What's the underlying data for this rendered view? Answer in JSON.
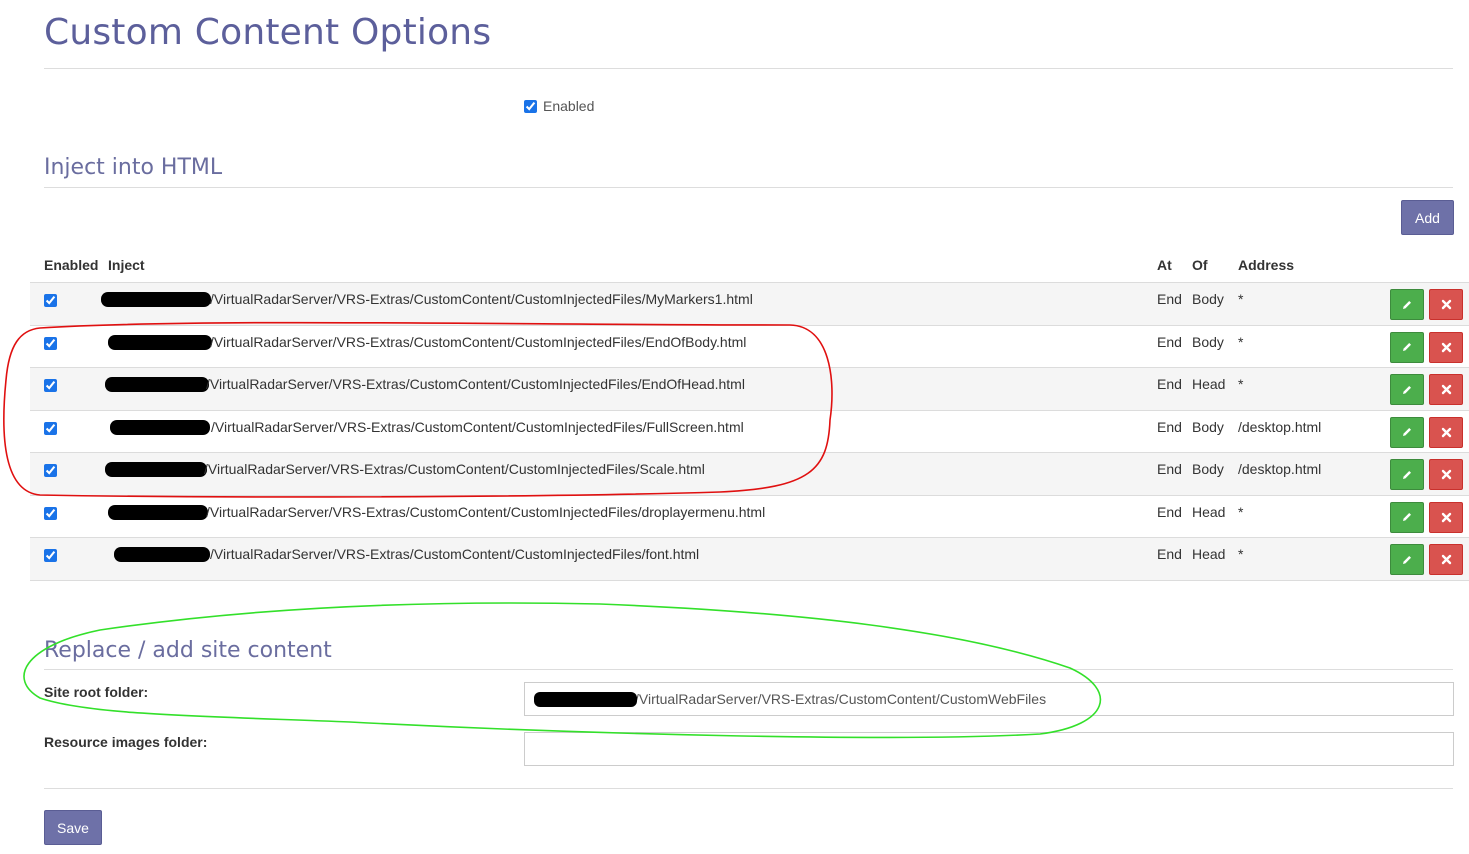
{
  "page": {
    "title": "Custom Content Options"
  },
  "enabled": {
    "label": "Enabled",
    "checked": true
  },
  "inject": {
    "section_title": "Inject into HTML",
    "add_label": "Add",
    "columns": {
      "enabled": "Enabled",
      "inject": "Inject",
      "at": "At",
      "of": "Of",
      "address": "Address"
    },
    "rows": [
      {
        "path": "/VirtualRadarServer/VRS-Extras/CustomContent/CustomInjectedFiles/MyMarkers1.html",
        "at": "End",
        "of": "Body",
        "address": "*",
        "enabled": true
      },
      {
        "path": "/VirtualRadarServer/VRS-Extras/CustomContent/CustomInjectedFiles/EndOfBody.html",
        "at": "End",
        "of": "Body",
        "address": "*",
        "enabled": true
      },
      {
        "path": "/VirtualRadarServer/VRS-Extras/CustomContent/CustomInjectedFiles/EndOfHead.html",
        "at": "End",
        "of": "Head",
        "address": "*",
        "enabled": true
      },
      {
        "path": "/VirtualRadarServer/VRS-Extras/CustomContent/CustomInjectedFiles/FullScreen.html",
        "at": "End",
        "of": "Body",
        "address": "/desktop.html",
        "enabled": true
      },
      {
        "path": "/VirtualRadarServer/VRS-Extras/CustomContent/CustomInjectedFiles/Scale.html",
        "at": "End",
        "of": "Body",
        "address": "/desktop.html",
        "enabled": true
      },
      {
        "path": "/VirtualRadarServer/VRS-Extras/CustomContent/CustomInjectedFiles/droplayermenu.html",
        "at": "End",
        "of": "Head",
        "address": "*",
        "enabled": true
      },
      {
        "path": "/VirtualRadarServer/VRS-Extras/CustomContent/CustomInjectedFiles/font.html",
        "at": "End",
        "of": "Head",
        "address": "*",
        "enabled": true
      }
    ]
  },
  "site": {
    "section_title": "Replace / add site content",
    "root_label": "Site root folder:",
    "root_value": "/VirtualRadarServer/VRS-Extras/CustomContent/CustomWebFiles",
    "images_label": "Resource images folder:",
    "images_value": ""
  },
  "save_label": "Save",
  "icons": {
    "edit": "pencil-icon",
    "delete": "close-icon"
  },
  "colors": {
    "title": "#5c5f9b",
    "primary_button": "#6e71a8",
    "edit_button": "#4cae4c",
    "delete_button": "#d9534f",
    "annotation_red": "#e01010",
    "annotation_green": "#33e02a"
  }
}
